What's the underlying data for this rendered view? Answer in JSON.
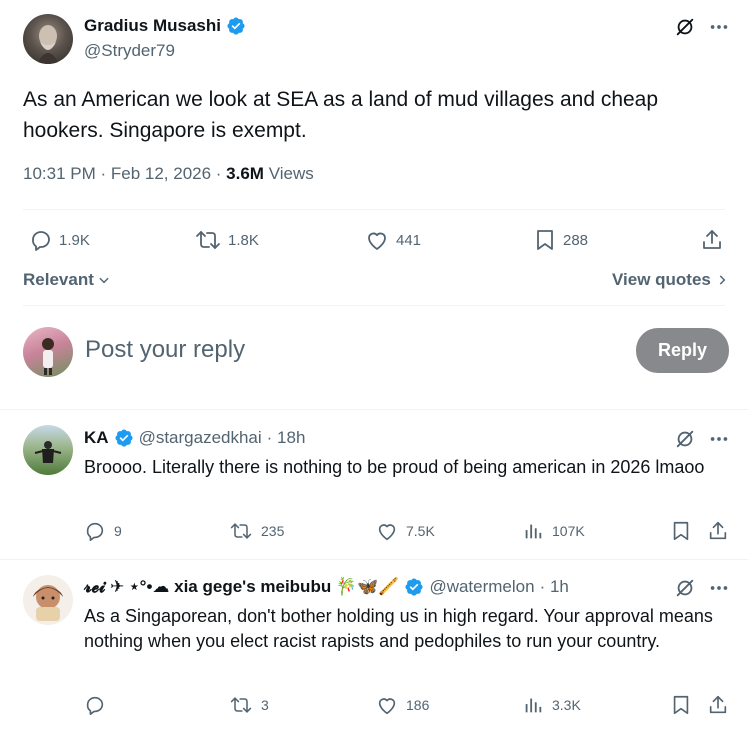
{
  "main_tweet": {
    "author_name": "Gradius Musashi",
    "handle": "@Stryder79",
    "text": "As an American we look at SEA as a land of mud villages and cheap hookers. Singapore is exempt.",
    "time": "10:31 PM · Feb 12, 2026 · ",
    "views_count": "3.6M",
    "views_label": " Views",
    "stats": {
      "replies": "1.9K",
      "retweets": "1.8K",
      "likes": "441",
      "bookmarks": "288"
    }
  },
  "sort": {
    "relevant_label": "Relevant",
    "view_quotes_label": "View quotes"
  },
  "composer": {
    "placeholder": "Post your reply",
    "reply_button": "Reply"
  },
  "replies": [
    {
      "author_name": "KA",
      "handle": "@stargazedkhai",
      "time": " · 18h",
      "text": "Broooo. Literally there is nothing to be proud of being american in 2026 lmaoo",
      "replies": "9",
      "retweets": "235",
      "likes": "7.5K",
      "views": "107K"
    },
    {
      "author_name": "𝓻𝓮𝓲 ✈ ⋆°•☁ xia gege's meibubu 🎋🦋🪈",
      "handle": "@watermelon",
      "time": " · 1h",
      "text": "As a Singaporean, don't bother holding us in high regard. Your approval means nothing when you elect racist rapists and pedophiles to run your country.",
      "replies": "",
      "retweets": "3",
      "likes": "186",
      "views": "3.3K"
    }
  ],
  "colors": {
    "verified": "#1d9bf0",
    "muted": "#536471",
    "divider": "#eff3f4",
    "reply_button_bg": "#87898c"
  },
  "icons": [
    "verified-badge-icon",
    "grok-icon",
    "more-icon",
    "reply-icon",
    "retweet-icon",
    "like-icon",
    "bookmark-icon",
    "share-icon",
    "views-icon",
    "chevron-down-icon",
    "chevron-right-icon"
  ]
}
